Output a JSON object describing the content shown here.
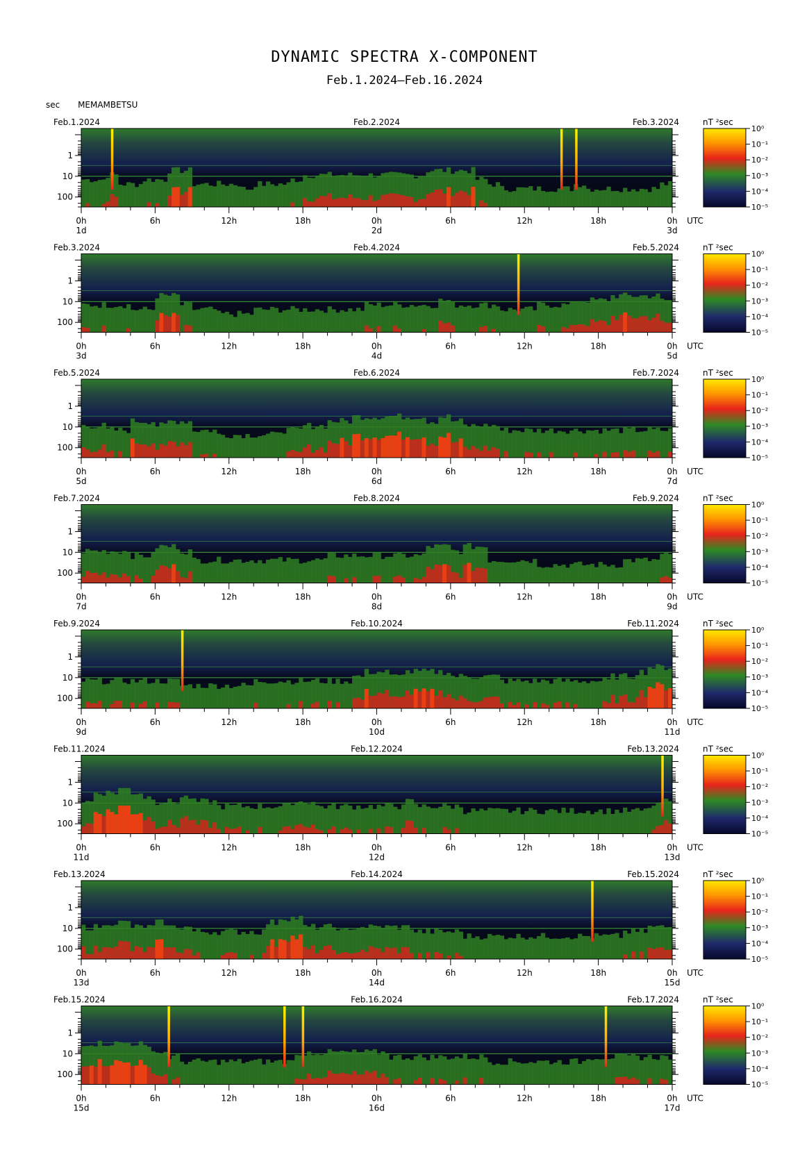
{
  "title": "DYNAMIC SPECTRA X-COMPONENT",
  "subtitle": "Feb.1.2024–Feb.16.2024",
  "y_unit": "sec",
  "station": "MEMAMBETSU",
  "colors": {
    "background": "#0b1030",
    "low_power": "#1f2a6b",
    "mid_power": "#2e8a25",
    "high_power": "#e8241b",
    "peak_power": "#ffe100"
  },
  "chart_data": [
    {
      "type": "heatmap",
      "start_label": "Feb.1.2024",
      "mid_label": "Feb.2.2024",
      "end_label": "Feb.3.2024",
      "unit_label": "nT ²sec",
      "day_labels": [
        "1d",
        "2d",
        "3d"
      ],
      "spikes_hour": [
        2.5,
        39.0,
        40.2
      ],
      "activity": [
        0.6,
        0.6,
        0.7,
        0.5,
        0.5,
        0.6,
        0.6,
        0.8,
        0.8,
        0.5,
        0.5,
        0.5,
        0.5,
        0.4,
        0.5,
        0.5,
        0.5,
        0.6,
        0.7,
        0.7,
        0.7,
        0.7,
        0.7,
        0.7,
        0.7,
        0.7,
        0.7,
        0.7,
        0.8,
        0.8,
        0.8,
        0.8,
        0.6,
        0.5,
        0.4,
        0.4,
        0.4,
        0.4,
        0.4,
        0.4,
        0.5,
        0.4,
        0.4,
        0.4,
        0.4,
        0.4,
        0.4,
        0.5
      ]
    },
    {
      "type": "heatmap",
      "start_label": "Feb.3.2024",
      "mid_label": "Feb.4.2024",
      "end_label": "Feb.5.2024",
      "unit_label": "nT ²sec",
      "day_labels": [
        "3d",
        "4d",
        "5d"
      ],
      "spikes_hour": [
        35.5
      ],
      "activity": [
        0.6,
        0.6,
        0.6,
        0.6,
        0.5,
        0.5,
        0.8,
        0.8,
        0.6,
        0.5,
        0.5,
        0.4,
        0.4,
        0.4,
        0.5,
        0.5,
        0.5,
        0.5,
        0.5,
        0.5,
        0.5,
        0.5,
        0.5,
        0.6,
        0.6,
        0.6,
        0.6,
        0.6,
        0.6,
        0.7,
        0.6,
        0.6,
        0.6,
        0.6,
        0.5,
        0.5,
        0.5,
        0.6,
        0.6,
        0.6,
        0.7,
        0.7,
        0.7,
        0.8,
        0.8,
        0.8,
        0.8,
        0.7
      ]
    },
    {
      "type": "heatmap",
      "start_label": "Feb.5.2024",
      "mid_label": "Feb.6.2024",
      "end_label": "Feb.7.2024",
      "unit_label": "nT ²sec",
      "day_labels": [
        "5d",
        "6d",
        "7d"
      ],
      "spikes_hour": [],
      "activity": [
        0.7,
        0.7,
        0.6,
        0.6,
        0.8,
        0.8,
        0.7,
        0.8,
        0.8,
        0.6,
        0.6,
        0.5,
        0.5,
        0.5,
        0.5,
        0.5,
        0.6,
        0.6,
        0.7,
        0.7,
        0.8,
        0.8,
        0.9,
        0.9,
        0.9,
        0.9,
        0.9,
        0.9,
        0.8,
        0.9,
        0.8,
        0.7,
        0.7,
        0.7,
        0.6,
        0.6,
        0.6,
        0.6,
        0.6,
        0.6,
        0.6,
        0.6,
        0.6,
        0.6,
        0.6,
        0.6,
        0.6,
        0.6
      ]
    },
    {
      "type": "heatmap",
      "start_label": "Feb.7.2024",
      "mid_label": "Feb.8.2024",
      "end_label": "Feb.9.2024",
      "unit_label": "nT ²sec",
      "day_labels": [
        "7d",
        "8d",
        "9d"
      ],
      "spikes_hour": [],
      "activity": [
        0.7,
        0.7,
        0.7,
        0.7,
        0.6,
        0.6,
        0.8,
        0.8,
        0.7,
        0.5,
        0.5,
        0.5,
        0.5,
        0.5,
        0.5,
        0.5,
        0.5,
        0.5,
        0.5,
        0.5,
        0.6,
        0.6,
        0.6,
        0.6,
        0.6,
        0.6,
        0.6,
        0.6,
        0.8,
        0.8,
        0.7,
        0.8,
        0.8,
        0.5,
        0.5,
        0.5,
        0.5,
        0.4,
        0.4,
        0.4,
        0.4,
        0.4,
        0.4,
        0.4,
        0.5,
        0.5,
        0.5,
        0.6
      ]
    },
    {
      "type": "heatmap",
      "start_label": "Feb.9.2024",
      "mid_label": "Feb.10.2024",
      "end_label": "Feb.11.2024",
      "unit_label": "nT ²sec",
      "day_labels": [
        "9d",
        "10d",
        "11d"
      ],
      "spikes_hour": [
        8.2
      ],
      "activity": [
        0.6,
        0.6,
        0.6,
        0.6,
        0.6,
        0.6,
        0.6,
        0.6,
        0.5,
        0.5,
        0.5,
        0.5,
        0.5,
        0.5,
        0.6,
        0.6,
        0.6,
        0.6,
        0.6,
        0.6,
        0.6,
        0.6,
        0.7,
        0.8,
        0.8,
        0.7,
        0.8,
        0.8,
        0.8,
        0.8,
        0.7,
        0.7,
        0.7,
        0.7,
        0.6,
        0.6,
        0.6,
        0.6,
        0.6,
        0.6,
        0.6,
        0.6,
        0.6,
        0.7,
        0.7,
        0.8,
        0.9,
        0.9
      ]
    },
    {
      "type": "heatmap",
      "start_label": "Feb.11.2024",
      "mid_label": "Feb.12.2024",
      "end_label": "Feb.13.2024",
      "unit_label": "nT ²sec",
      "day_labels": [
        "11d",
        "12d",
        "13d"
      ],
      "spikes_hour": [
        47.2
      ],
      "activity": [
        0.7,
        0.9,
        0.9,
        1.0,
        0.9,
        0.8,
        0.7,
        0.7,
        0.8,
        0.7,
        0.7,
        0.6,
        0.6,
        0.6,
        0.6,
        0.6,
        0.6,
        0.7,
        0.7,
        0.6,
        0.6,
        0.6,
        0.6,
        0.6,
        0.6,
        0.6,
        0.7,
        0.6,
        0.6,
        0.6,
        0.6,
        0.5,
        0.5,
        0.5,
        0.5,
        0.5,
        0.5,
        0.5,
        0.5,
        0.5,
        0.5,
        0.5,
        0.5,
        0.5,
        0.5,
        0.5,
        0.6,
        0.7
      ]
    },
    {
      "type": "heatmap",
      "start_label": "Feb.13.2024",
      "mid_label": "Feb.14.2024",
      "end_label": "Feb.15.2024",
      "unit_label": "nT ²sec",
      "day_labels": [
        "13d",
        "14d",
        "15d"
      ],
      "spikes_hour": [
        41.5
      ],
      "activity": [
        0.7,
        0.7,
        0.8,
        0.8,
        0.7,
        0.7,
        0.8,
        0.7,
        0.7,
        0.6,
        0.6,
        0.6,
        0.6,
        0.6,
        0.6,
        0.8,
        0.9,
        0.9,
        0.7,
        0.7,
        0.7,
        0.6,
        0.7,
        0.7,
        0.7,
        0.7,
        0.7,
        0.6,
        0.6,
        0.6,
        0.6,
        0.5,
        0.5,
        0.5,
        0.5,
        0.5,
        0.5,
        0.5,
        0.5,
        0.5,
        0.5,
        0.5,
        0.5,
        0.5,
        0.6,
        0.6,
        0.7,
        0.7
      ]
    },
    {
      "type": "heatmap",
      "start_label": "Feb.15.2024",
      "mid_label": "Feb.16.2024",
      "end_label": "Feb.17.2024",
      "unit_label": "nT ²sec",
      "day_labels": [
        "15d",
        "16d",
        "17d"
      ],
      "spikes_hour": [
        7.1,
        16.5,
        18.0,
        42.6
      ],
      "activity": [
        0.9,
        0.9,
        0.9,
        0.9,
        0.9,
        0.8,
        0.7,
        0.6,
        0.5,
        0.5,
        0.5,
        0.5,
        0.5,
        0.5,
        0.5,
        0.5,
        0.5,
        0.6,
        0.7,
        0.7,
        0.7,
        0.7,
        0.7,
        0.7,
        0.7,
        0.6,
        0.6,
        0.6,
        0.6,
        0.6,
        0.6,
        0.6,
        0.6,
        0.5,
        0.5,
        0.5,
        0.5,
        0.5,
        0.5,
        0.5,
        0.5,
        0.6,
        0.6,
        0.6,
        0.6,
        0.6,
        0.6,
        0.6
      ]
    }
  ],
  "axis": {
    "y_ticks": [
      "1",
      "10",
      "100"
    ],
    "x_ticks": [
      "0h",
      "6h",
      "12h",
      "18h",
      "0h",
      "6h",
      "12h",
      "18h",
      "0h"
    ],
    "x_unit": "UTC",
    "colorbar_ticks": [
      "10⁰",
      "10⁻¹",
      "10⁻²",
      "10⁻³",
      "10⁻⁴",
      "10⁻⁵"
    ]
  }
}
